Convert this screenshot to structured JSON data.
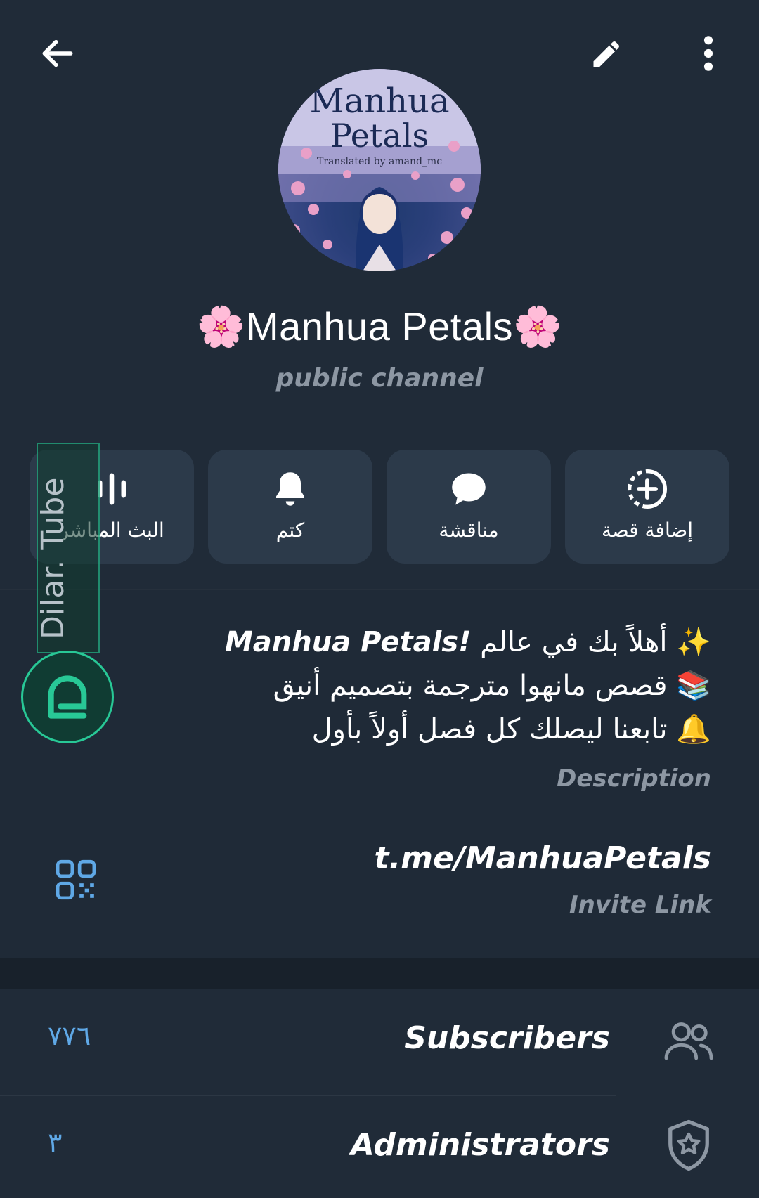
{
  "channel": {
    "avatar": {
      "title_line1": "Manhua",
      "title_line2": "Petals",
      "credit": "Translated by amand_mc"
    },
    "name": "🌸Manhua Petals🌸",
    "type": "public channel"
  },
  "actions": [
    {
      "label": "البث المباشر",
      "icon": "live-stream-icon"
    },
    {
      "label": "كتم",
      "icon": "bell-icon"
    },
    {
      "label": "مناقشة",
      "icon": "chat-bubble-icon"
    },
    {
      "label": "إضافة قصة",
      "icon": "add-story-icon"
    }
  ],
  "description": {
    "line1_prefix": "✨ أهلاً بك في عالم ",
    "line1_bold": "Manhua Petals!",
    "line2": "📚 قصص مانهوا مترجمة بتصميم أنيق",
    "line3": "🔔 تابعنا ليصلك كل فصل أولاً بأول",
    "caption": "Description"
  },
  "invite": {
    "link": "t.me/ManhuaPetals",
    "caption": "Invite Link"
  },
  "stats": {
    "subscribers_label": "Subscribers",
    "subscribers_count": "٧٧٦",
    "admins_label": "Administrators",
    "admins_count": "٣"
  },
  "watermark": {
    "text": "Dilar. Tube"
  },
  "colors": {
    "background": "#202b38",
    "card": "#2c3a4a",
    "accent": "#5fa8e6",
    "muted": "#8d97a3"
  }
}
